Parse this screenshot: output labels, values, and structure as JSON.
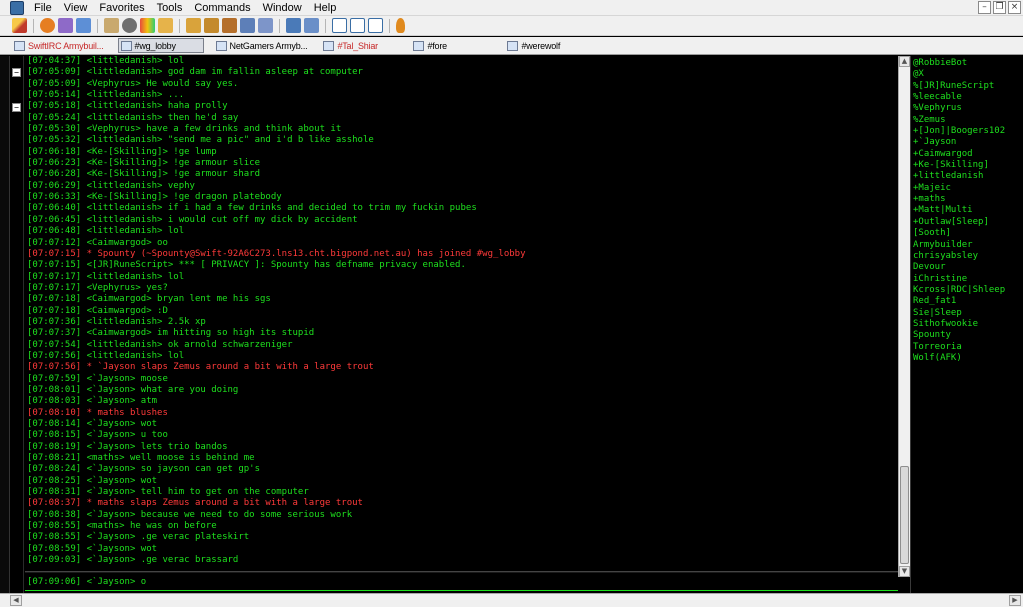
{
  "menubar": {
    "items": [
      "File",
      "View",
      "Favorites",
      "Tools",
      "Commands",
      "Window",
      "Help"
    ]
  },
  "switchbar": {
    "tabs": [
      {
        "label": "SwiftIRC Armybuil...",
        "active": false,
        "highlight": true
      },
      {
        "label": "#wg_lobby",
        "active": true,
        "highlight": false
      },
      {
        "label": "NetGamers Armyb...",
        "active": false,
        "highlight": false
      },
      {
        "label": "#Tal_Shiar",
        "active": false,
        "highlight": true
      },
      {
        "label": "#fore",
        "active": false,
        "highlight": false
      },
      {
        "label": "#werewolf",
        "active": false,
        "highlight": false
      }
    ]
  },
  "chat": {
    "lines": [
      {
        "text": "[07:04:37] <littledanish> lol",
        "type": "msg"
      },
      {
        "text": "[07:05:09] <littledanish> god dam im fallin asleep at computer",
        "type": "msg"
      },
      {
        "text": "[07:05:09] <Vephyrus> He would say yes.",
        "type": "msg"
      },
      {
        "text": "[07:05:14] <littledanish> ...",
        "type": "msg"
      },
      {
        "text": "[07:05:18] <littledanish> haha prolly",
        "type": "msg"
      },
      {
        "text": "[07:05:24] <littledanish> then he'd say",
        "type": "msg"
      },
      {
        "text": "[07:05:30] <Vephyrus> have a few drinks and think about it",
        "type": "msg"
      },
      {
        "text": "[07:05:32] <littledanish> \"send me a pic\" and i'd b like asshole",
        "type": "msg"
      },
      {
        "text": "[07:06:18] <Ke-[Skilling]> !ge lump",
        "type": "msg"
      },
      {
        "text": "[07:06:23] <Ke-[Skilling]> !ge armour slice",
        "type": "msg"
      },
      {
        "text": "[07:06:28] <Ke-[Skilling]> !ge armour shard",
        "type": "msg"
      },
      {
        "text": "[07:06:29] <littledanish> vephy",
        "type": "msg"
      },
      {
        "text": "[07:06:33] <Ke-[Skilling]> !ge dragon platebody",
        "type": "msg"
      },
      {
        "text": "[07:06:40] <littledanish> if i had a few drinks and decided to trim my fuckin pubes",
        "type": "msg"
      },
      {
        "text": "[07:06:45] <littledanish> i would cut off my dick by accident",
        "type": "msg"
      },
      {
        "text": "[07:06:48] <littledanish> lol",
        "type": "msg"
      },
      {
        "text": "[07:07:12] <Caimwargod> oo",
        "type": "msg"
      },
      {
        "text": "[07:07:15] * Spounty (~Spounty@Swift-92A6C273.lns13.cht.bigpond.net.au) has joined #wg_lobby",
        "type": "action"
      },
      {
        "text": "[07:07:15] <[JR]RuneScript> *** [ PRIVACY ]: Spounty has defname privacy enabled.",
        "type": "msg"
      },
      {
        "text": "[07:07:17] <littledanish> lol",
        "type": "msg"
      },
      {
        "text": "[07:07:17] <Vephyrus> yes?",
        "type": "msg"
      },
      {
        "text": "[07:07:18] <Caimwargod> bryan lent me his sgs",
        "type": "msg"
      },
      {
        "text": "[07:07:18] <Caimwargod> :D",
        "type": "msg"
      },
      {
        "text": "[07:07:36] <littledanish> 2.5k xp",
        "type": "msg"
      },
      {
        "text": "[07:07:37] <Caimwargod> im hitting so high its stupid",
        "type": "msg"
      },
      {
        "text": "[07:07:54] <littledanish> ok arnold schwarzeniger",
        "type": "msg"
      },
      {
        "text": "[07:07:56] <littledanish> lol",
        "type": "msg"
      },
      {
        "text": "[07:07:56] * `Jayson slaps Zemus around a bit with a large trout",
        "type": "action"
      },
      {
        "text": "[07:07:59] <`Jayson> moose",
        "type": "msg"
      },
      {
        "text": "[07:08:01] <`Jayson> what are you doing",
        "type": "msg"
      },
      {
        "text": "[07:08:03] <`Jayson> atm",
        "type": "msg"
      },
      {
        "text": "[07:08:10] * maths blushes",
        "type": "action"
      },
      {
        "text": "[07:08:14] <`Jayson> wot",
        "type": "msg"
      },
      {
        "text": "[07:08:15] <`Jayson> u too",
        "type": "msg"
      },
      {
        "text": "[07:08:19] <`Jayson> lets trio bandos",
        "type": "msg"
      },
      {
        "text": "[07:08:21] <maths> well moose is behind me",
        "type": "msg"
      },
      {
        "text": "[07:08:24] <`Jayson> so jayson can get gp's",
        "type": "msg"
      },
      {
        "text": "[07:08:25] <`Jayson> wot",
        "type": "msg"
      },
      {
        "text": "[07:08:31] <`Jayson> tell him to get on the computer",
        "type": "msg"
      },
      {
        "text": "[07:08:37] * maths slaps Zemus around a bit with a large trout",
        "type": "action"
      },
      {
        "text": "[07:08:38] <`Jayson> because we need to do some serious work",
        "type": "msg"
      },
      {
        "text": "[07:08:55] <maths> he was on before",
        "type": "msg"
      },
      {
        "text": "[07:08:55] <`Jayson> .ge verac plateskirt",
        "type": "msg"
      },
      {
        "text": "[07:08:59] <`Jayson> wot",
        "type": "msg"
      },
      {
        "text": "[07:09:03] <`Jayson> .ge verac brassard",
        "type": "msg"
      }
    ],
    "input_value": "[07:09:06] <`Jayson> o"
  },
  "nicklist": {
    "nicks": [
      "@RobbieBot",
      "@X",
      "%[JR]RuneScript",
      "%leecable",
      "%Vephyrus",
      "%Zemus",
      "+[Jon]|Boogers102",
      "+`Jayson",
      "+Caimwargod",
      "+Ke-[Skilling]",
      "+littledanish",
      "+Majeic",
      "+maths",
      "+Matt|Multi",
      "+Outlaw[Sleep]",
      "[Sooth]",
      "Armybuilder",
      "chrisyabsley",
      "Devour",
      "iChristine",
      "Kcross|RDC|Shleep",
      "Red_fat1",
      "Sie|Sleep",
      "Sithofwookie",
      "Spounty",
      "Torreoria",
      "Wolf(AFK)"
    ]
  },
  "colors": {
    "chat_text": "#1ee01e",
    "action_text": "#ff3a3a",
    "background": "#000000"
  }
}
